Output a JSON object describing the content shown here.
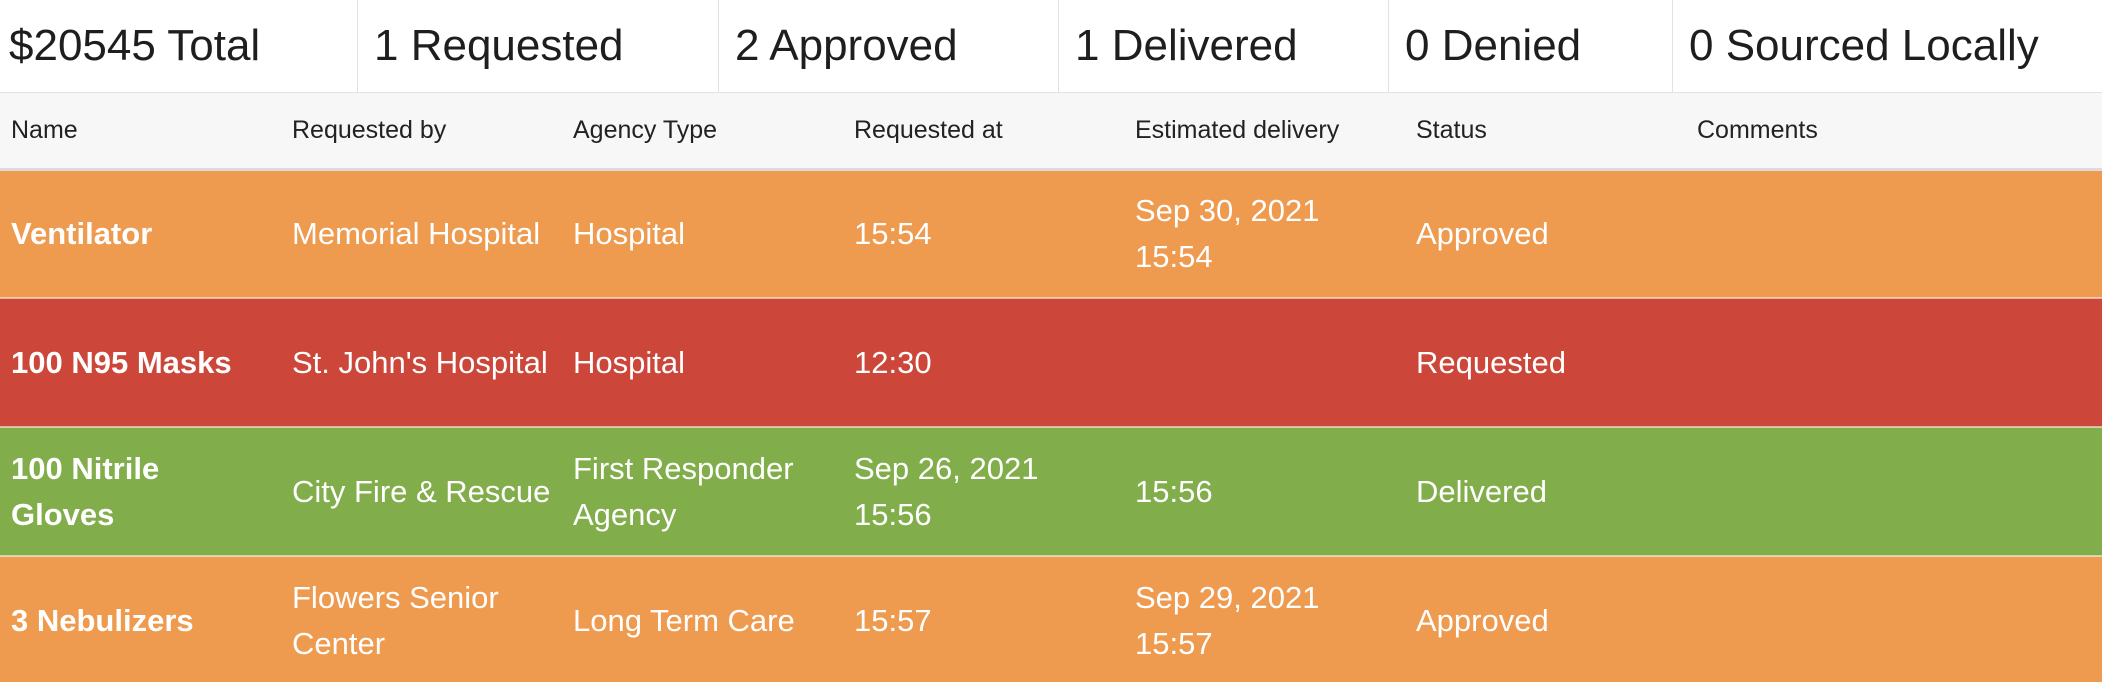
{
  "summary": {
    "total": "$20545 Total",
    "requested": "1 Requested",
    "approved": "2 Approved",
    "delivered": "1 Delivered",
    "denied": "0 Denied",
    "sourced_locally": "0 Sourced Locally"
  },
  "table": {
    "headers": {
      "name": "Name",
      "requested_by": "Requested by",
      "agency_type": "Agency Type",
      "requested_at": "Requested at",
      "estimated_delivery": "Estimated delivery",
      "status": "Status",
      "comments": "Comments"
    },
    "rows": [
      {
        "name": "Ventilator",
        "requested_by": "Memorial Hospital",
        "agency_type": "Hospital",
        "requested_at": "15:54",
        "estimated_delivery": "Sep 30, 2021 15:54",
        "status": "Approved",
        "comments": ""
      },
      {
        "name": "100 N95 Masks",
        "requested_by": "St. John's Hospital",
        "agency_type": "Hospital",
        "requested_at": "12:30",
        "estimated_delivery": "",
        "status": "Requested",
        "comments": ""
      },
      {
        "name": "100 Nitrile Gloves",
        "requested_by": "City Fire & Rescue",
        "agency_type": "First Responder Agency",
        "requested_at": "Sep 26, 2021 15:56",
        "estimated_delivery": "15:56",
        "status": "Delivered",
        "comments": ""
      },
      {
        "name": "3 Nebulizers",
        "requested_by": "Flowers Senior Center",
        "agency_type": "Long Term Care",
        "requested_at": "15:57",
        "estimated_delivery": "Sep 29, 2021 15:57",
        "status": "Approved",
        "comments": ""
      }
    ]
  },
  "colors": {
    "approved": "#ee9a4f",
    "requested": "#cc4639",
    "delivered": "#81ad4a"
  }
}
